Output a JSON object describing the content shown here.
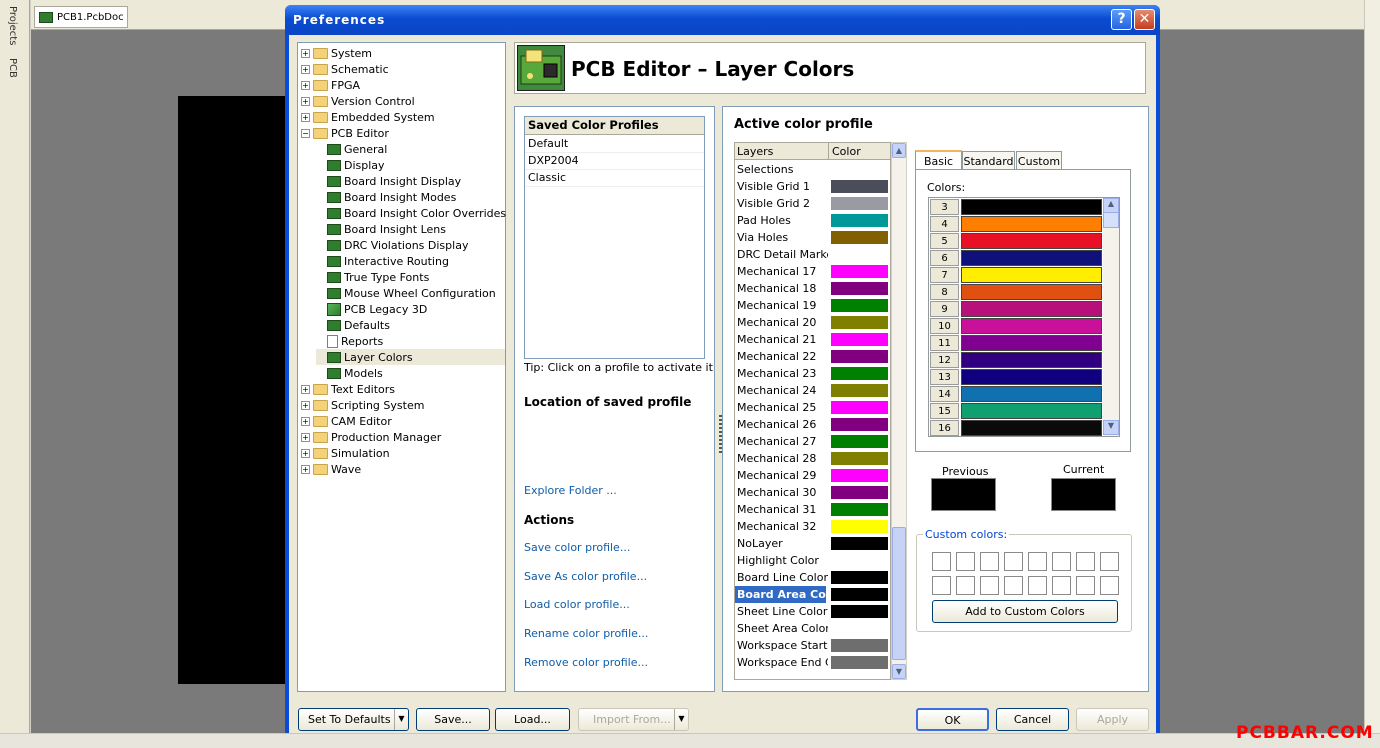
{
  "sidebar": {
    "tabs": [
      "Projects",
      "PCB"
    ]
  },
  "document": {
    "tab_label": "PCB1.PcbDoc"
  },
  "watermark": "PCBBAR.COM",
  "dialog": {
    "title": "Preferences",
    "help": "?",
    "close": "✕",
    "header_title": "PCB Editor – Layer Colors"
  },
  "tree": {
    "top": [
      "System",
      "Schematic",
      "FPGA",
      "Version Control",
      "Embedded System",
      "PCB Editor"
    ],
    "pcb_children": [
      "General",
      "Display",
      "Board Insight Display",
      "Board Insight Modes",
      "Board Insight Color Overrides",
      "Board Insight Lens",
      "DRC Violations Display",
      "Interactive Routing",
      "True Type Fonts",
      "Mouse Wheel Configuration",
      "PCB Legacy 3D",
      "Defaults",
      "Reports",
      "Layer Colors",
      "Models"
    ],
    "bottom": [
      "Text Editors",
      "Scripting System",
      "CAM Editor",
      "Production Manager",
      "Simulation",
      "Wave"
    ],
    "collapsed": "+",
    "expanded": "−",
    "selected": "Layer Colors"
  },
  "profiles": {
    "header": "Saved Color Profiles",
    "items": [
      "Default",
      "DXP2004",
      "Classic"
    ],
    "tip": "Tip: Click on a profile to activate it",
    "location_title": "Location of saved profile",
    "explore": "Explore Folder ...",
    "actions_title": "Actions",
    "actions": [
      "Save color profile...",
      "Save As color profile...",
      "Load color profile...",
      "Rename color profile...",
      "Remove color profile..."
    ]
  },
  "active_profile": {
    "title": "Active color profile",
    "col_layers": "Layers",
    "col_color": "Color",
    "layers": [
      {
        "name": "Selections",
        "color": "#ffffff"
      },
      {
        "name": "Visible Grid 1",
        "color": "#4b4d5b"
      },
      {
        "name": "Visible Grid 2",
        "color": "#9a9aa2"
      },
      {
        "name": "Pad Holes",
        "color": "#00999a"
      },
      {
        "name": "Via Holes",
        "color": "#806000"
      },
      {
        "name": "DRC Detail Markers",
        "color": "#ffffff"
      },
      {
        "name": "Mechanical 17",
        "color": "#ff00ff"
      },
      {
        "name": "Mechanical 18",
        "color": "#800080"
      },
      {
        "name": "Mechanical 19",
        "color": "#008000"
      },
      {
        "name": "Mechanical 20",
        "color": "#808000"
      },
      {
        "name": "Mechanical 21",
        "color": "#ff00ff"
      },
      {
        "name": "Mechanical 22",
        "color": "#800080"
      },
      {
        "name": "Mechanical 23",
        "color": "#008000"
      },
      {
        "name": "Mechanical 24",
        "color": "#808000"
      },
      {
        "name": "Mechanical 25",
        "color": "#ff00ff"
      },
      {
        "name": "Mechanical 26",
        "color": "#800080"
      },
      {
        "name": "Mechanical 27",
        "color": "#008000"
      },
      {
        "name": "Mechanical 28",
        "color": "#808000"
      },
      {
        "name": "Mechanical 29",
        "color": "#ff00ff"
      },
      {
        "name": "Mechanical 30",
        "color": "#800080"
      },
      {
        "name": "Mechanical 31",
        "color": "#008000"
      },
      {
        "name": "Mechanical 32",
        "color": "#ffff00"
      },
      {
        "name": "NoLayer",
        "color": "#000000"
      },
      {
        "name": "Highlight Color",
        "color": "#ffffff"
      },
      {
        "name": "Board Line Color",
        "color": "#000000"
      },
      {
        "name": "Board Area Color",
        "color": "#000000"
      },
      {
        "name": "Sheet Line Color",
        "color": "#000000"
      },
      {
        "name": "Sheet Area Color",
        "color": "#ffffff"
      },
      {
        "name": "Workspace Start Color",
        "color": "#6e6e6e"
      },
      {
        "name": "Workspace End Color",
        "color": "#6e6e6e"
      }
    ],
    "selected": "Board Area Color"
  },
  "color_picker": {
    "tabs": [
      "Basic",
      "Standard",
      "Custom"
    ],
    "colors_label": "Colors:",
    "palette": [
      {
        "n": "3",
        "color": "#000000"
      },
      {
        "n": "4",
        "color": "#ff8000"
      },
      {
        "n": "5",
        "color": "#e81024"
      },
      {
        "n": "6",
        "color": "#10107a"
      },
      {
        "n": "7",
        "color": "#ffee00"
      },
      {
        "n": "8",
        "color": "#e05010"
      },
      {
        "n": "9",
        "color": "#b8107a"
      },
      {
        "n": "10",
        "color": "#c8109a"
      },
      {
        "n": "11",
        "color": "#800090"
      },
      {
        "n": "12",
        "color": "#300080"
      },
      {
        "n": "13",
        "color": "#100080"
      },
      {
        "n": "14",
        "color": "#1070b0"
      },
      {
        "n": "15",
        "color": "#10a070"
      },
      {
        "n": "16",
        "color": "#0a0a0a"
      }
    ],
    "previous_label": "Previous",
    "current_label": "Current",
    "previous_color": "#000000",
    "current_color": "#000000",
    "custom_label": "Custom colors:",
    "add_custom": "Add to Custom Colors"
  },
  "footer": {
    "set_defaults": "Set To Defaults",
    "save": "Save...",
    "load": "Load...",
    "import_from": "Import From...",
    "ok": "OK",
    "cancel": "Cancel",
    "apply": "Apply",
    "dropdown_icon": "▼"
  },
  "scroll_icons": {
    "up": "▲",
    "down": "▼"
  }
}
